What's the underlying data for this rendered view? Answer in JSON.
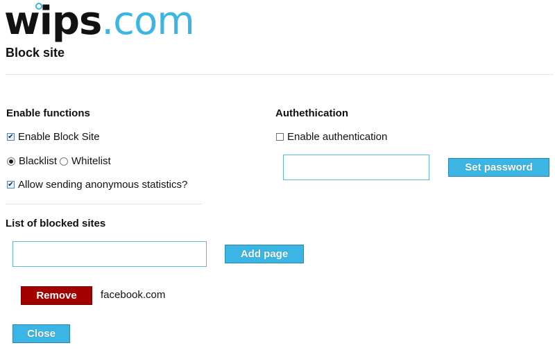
{
  "header": {
    "logo_main": "wips",
    "logo_suffix": ".com",
    "page_title": "Block site"
  },
  "enable_functions": {
    "title": "Enable functions",
    "enable_block_site": {
      "label": "Enable Block Site",
      "checked": true
    },
    "mode": {
      "options": [
        "Blacklist",
        "Whitelist"
      ],
      "selected": "Blacklist"
    },
    "anonymous_stats": {
      "label": "Allow sending anonymous statistics?",
      "checked": true
    }
  },
  "authentication": {
    "title": "Authethication",
    "enable_auth": {
      "label": "Enable authentication",
      "checked": false
    },
    "password_value": "",
    "set_password_label": "Set password"
  },
  "blocked_sites": {
    "title": "List of blocked sites",
    "new_page_value": "",
    "add_page_label": "Add page",
    "remove_label": "Remove",
    "items": [
      {
        "site": "facebook.com"
      }
    ]
  },
  "footer": {
    "close_label": "Close"
  },
  "colors": {
    "accent": "#3bb6e4",
    "danger": "#a30000"
  }
}
